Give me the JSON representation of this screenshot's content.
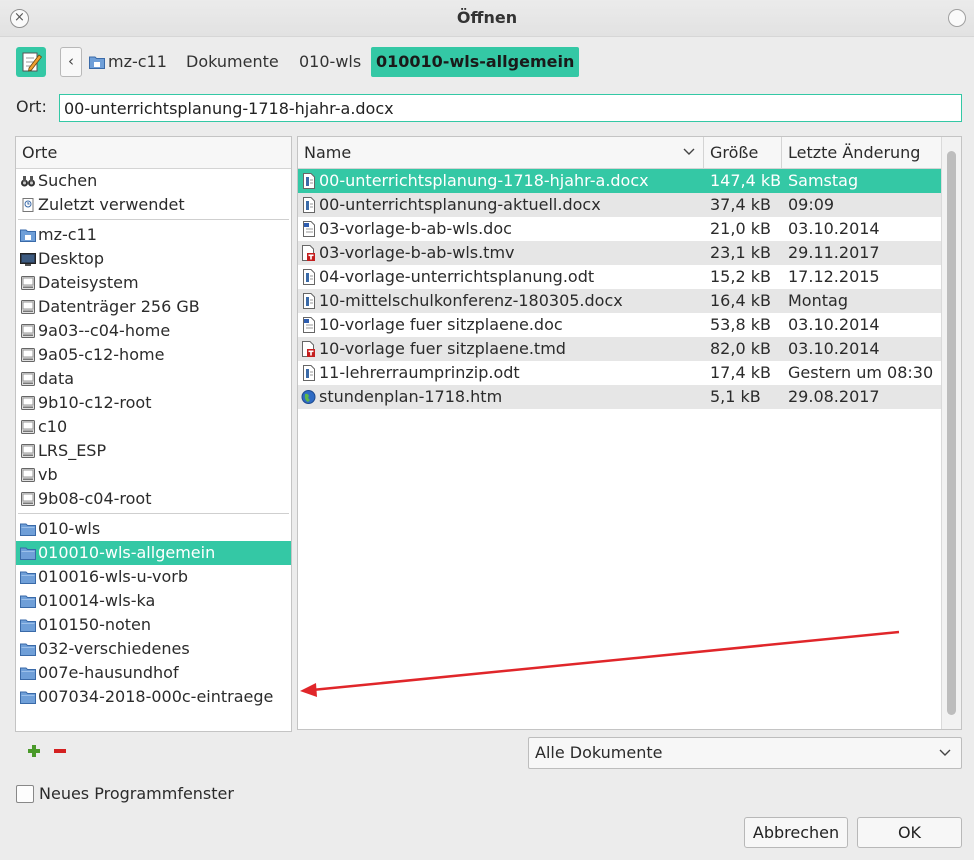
{
  "window": {
    "title": "Öffnen",
    "close_glyph": "×"
  },
  "toolbar": {
    "back_glyph": "‹",
    "breadcrumbs": [
      "mz-c11",
      "Dokumente",
      "010-wls",
      "010010-wls-allgemein"
    ]
  },
  "location": {
    "label": "Ort:",
    "value": "00-unterrichtsplanung-1718-hjahr-a.docx"
  },
  "places": {
    "header": "Orte",
    "group1": [
      {
        "label": "Suchen",
        "icon": "binoculars-icon"
      },
      {
        "label": "Zuletzt verwendet",
        "icon": "recent-icon"
      }
    ],
    "group2": [
      {
        "label": "mz-c11",
        "icon": "home-folder-icon"
      },
      {
        "label": "Desktop",
        "icon": "desktop-icon"
      },
      {
        "label": "Dateisystem",
        "icon": "drive-icon"
      },
      {
        "label": "Datenträger 256 GB",
        "icon": "drive-icon"
      },
      {
        "label": "9a03--c04-home",
        "icon": "drive-icon"
      },
      {
        "label": "9a05-c12-home",
        "icon": "drive-icon"
      },
      {
        "label": "data",
        "icon": "drive-icon"
      },
      {
        "label": "9b10-c12-root",
        "icon": "drive-icon"
      },
      {
        "label": "c10",
        "icon": "drive-icon"
      },
      {
        "label": "LRS_ESP",
        "icon": "drive-icon"
      },
      {
        "label": "vb",
        "icon": "drive-icon"
      },
      {
        "label": "9b08-c04-root",
        "icon": "drive-icon"
      }
    ],
    "group3": [
      {
        "label": "010-wls",
        "icon": "folder-icon"
      },
      {
        "label": "010010-wls-allgemein",
        "icon": "folder-icon",
        "selected": true
      },
      {
        "label": "010016-wls-u-vorb",
        "icon": "folder-icon"
      },
      {
        "label": "010014-wls-ka",
        "icon": "folder-icon"
      },
      {
        "label": "010150-noten",
        "icon": "folder-icon"
      },
      {
        "label": "032-verschiedenes",
        "icon": "folder-icon"
      },
      {
        "label": "007e-hausundhof",
        "icon": "folder-icon"
      },
      {
        "label": "007034-2018-000c-eintraege",
        "icon": "folder-icon"
      }
    ]
  },
  "files": {
    "columns": {
      "name": "Name",
      "size": "Größe",
      "date": "Letzte Änderung"
    },
    "rows": [
      {
        "name": "00-unterrichtsplanung-1718-hjahr-a.docx",
        "size": "147,4 kB",
        "date": "Samstag",
        "icon": "writer-doc-icon",
        "selected": true
      },
      {
        "name": "00-unterrichtsplanung-aktuell.docx",
        "size": "37,4 kB",
        "date": "09:09",
        "icon": "writer-doc-icon"
      },
      {
        "name": "03-vorlage-b-ab-wls.doc",
        "size": "21,0 kB",
        "date": "03.10.2014",
        "icon": "word-doc-icon"
      },
      {
        "name": "03-vorlage-b-ab-wls.tmv",
        "size": "23,1 kB",
        "date": "29.11.2017",
        "icon": "template-icon"
      },
      {
        "name": "04-vorlage-unterrichtsplanung.odt",
        "size": "15,2 kB",
        "date": "17.12.2015",
        "icon": "writer-doc-icon"
      },
      {
        "name": "10-mittelschulkonferenz-180305.docx",
        "size": "16,4 kB",
        "date": "Montag",
        "icon": "writer-doc-icon"
      },
      {
        "name": "10-vorlage fuer sitzplaene.doc",
        "size": "53,8 kB",
        "date": "03.10.2014",
        "icon": "word-doc-icon"
      },
      {
        "name": "10-vorlage fuer sitzplaene.tmd",
        "size": "82,0 kB",
        "date": "03.10.2014",
        "icon": "template-icon"
      },
      {
        "name": "11-lehrerraumprinzip.odt",
        "size": "17,4 kB",
        "date": "Gestern um 08:30",
        "icon": "writer-doc-icon"
      },
      {
        "name": "stundenplan-1718.htm",
        "size": "5,1 kB",
        "date": "29.08.2017",
        "icon": "html-globe-icon"
      }
    ]
  },
  "filter": {
    "value": "Alle Dokumente"
  },
  "options": {
    "new_window_label": "Neues Programmfenster",
    "new_window_checked": false
  },
  "buttons": {
    "cancel": "Abbrechen",
    "ok": "OK"
  },
  "colors": {
    "accent": "#34c8a5",
    "annotation_arrow": "#e0262a"
  }
}
